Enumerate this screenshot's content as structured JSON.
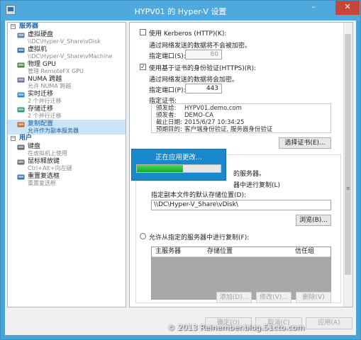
{
  "window": {
    "title": "HYPV01 的 Hyper-V 设置",
    "min": "–",
    "max": "□",
    "close": "✕"
  },
  "nav": {
    "server_header": "服务器",
    "user_header": "用户",
    "server_items": [
      {
        "name": "虚拟硬盘",
        "sub": "\\\\DC\\Hyper-V_Share\\vDisk",
        "icon": "virtual-disk-icon"
      },
      {
        "name": "虚拟机",
        "sub": "\\\\DC\\Hyper-V_Share\\vMachine",
        "icon": "virtual-machine-icon"
      },
      {
        "name": "物理 GPU",
        "sub": "管理 RemoteFX GPU",
        "icon": "gpu-icon"
      },
      {
        "name": "NUMA 跨越",
        "sub": "允许 NUMA 跨越",
        "icon": "numa-icon"
      },
      {
        "name": "实时迁移",
        "sub": "2 个并行迁移",
        "icon": "live-migration-icon"
      },
      {
        "name": "存储迁移",
        "sub": "2 个并行迁移",
        "icon": "storage-migration-icon"
      },
      {
        "name": "复制配置",
        "sub": "允许作为副本服务器",
        "icon": "replication-icon",
        "selected": true
      }
    ],
    "user_items": [
      {
        "name": "键盘",
        "sub": "在虚拟机上使用",
        "icon": "keyboard-icon"
      },
      {
        "name": "鼠标释放键",
        "sub": "Ctrl+Alt+向左键",
        "icon": "mouse-icon"
      },
      {
        "name": "重置复选框",
        "sub": "重置复选框",
        "icon": "reset-checkbox-icon"
      }
    ]
  },
  "panel": {
    "kerberos_label": "使用 Kerberos (HTTP)(K):",
    "kerberos_checked": false,
    "kerberos_desc": "通过网络发送的数据将不会被加密。",
    "kerberos_port_label": "指定端口(S):",
    "kerberos_port": "80",
    "https_label": "使用基于证书的身份验证(HTTPS)(R):",
    "https_checked": true,
    "https_desc": "通过网络发送的数据将会加密。",
    "https_port_label": "指定端口(P):",
    "https_port": "443",
    "cert_label": "指定证书:",
    "cert": {
      "issued_to_k": "颁发给:",
      "issued_to_v": "HYPV01.demo.com",
      "issuer_k": "颁发者:",
      "issuer_v": "DEMO-CA",
      "expire_k": "截止日期:",
      "expire_v": "2015/6/27 10:34:25",
      "purpose_k": "预期目的:",
      "purpose_v": "客户端身份验证, 服务器身份验证"
    },
    "select_cert_btn": "选择证书(E)...",
    "partial_servers": "的服务器。",
    "partial_replication": "器中进行复制(L)",
    "storage_label": "指定副本文件的默认存储位置(D):",
    "storage_path": "\\\\DC\\Hyper-V_Share\\vDisk\\",
    "browse_btn": "浏览(B)...",
    "allow_specified_label": "允许从指定的服务器中进行复制(F):",
    "table_headers": [
      "主服务器",
      "存储位置",
      "信任组"
    ],
    "add_btn": "添加(D)...",
    "edit_btn": "修改(V)...",
    "delete_btn": "删除(V)"
  },
  "progress": {
    "label": "正在应用更改...",
    "fraction": 0.55
  },
  "buttons": {
    "ok": "确定(O)",
    "cancel": "取消(C)",
    "apply": "应用(A)"
  },
  "watermark": "© 2013 Reinember.blog.51cto.com"
}
